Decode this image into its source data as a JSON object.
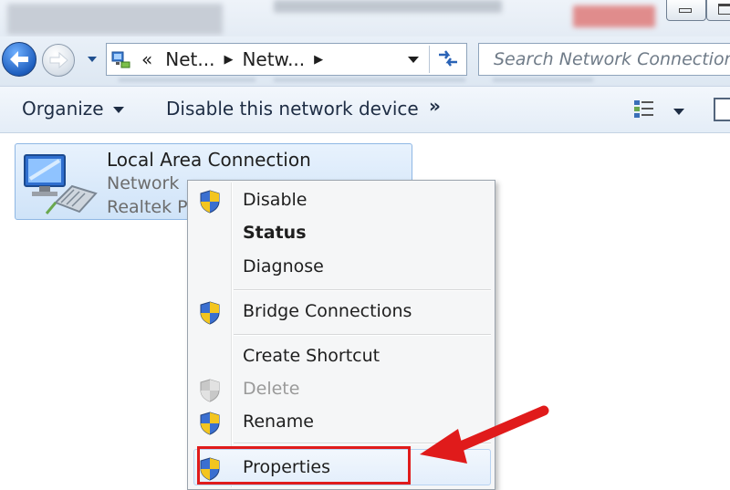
{
  "address_bar": {
    "overflow_glyph": "«",
    "crumbs": [
      "Net...",
      "Netw..."
    ],
    "search_placeholder": "Search Network Connections"
  },
  "toolbar": {
    "organize_label": "Organize",
    "disable_label": "Disable this network device",
    "more_glyph": "»"
  },
  "connection": {
    "name": "Local Area Connection",
    "status": "Network",
    "adapter": "Realtek PC"
  },
  "context_menu": {
    "items": [
      {
        "label": "Disable",
        "icon": "uac-shield-icon"
      },
      {
        "label": "Status"
      },
      {
        "label": "Diagnose"
      },
      {
        "label": "Bridge Connections",
        "icon": "uac-shield-icon"
      },
      {
        "label": "Create Shortcut"
      },
      {
        "label": "Delete",
        "icon": "uac-shield-icon",
        "state": "disabled"
      },
      {
        "label": "Rename",
        "icon": "uac-shield-icon"
      },
      {
        "label": "Properties",
        "icon": "uac-shield-icon",
        "state": "hovered"
      }
    ]
  },
  "colors": {
    "accent_blue": "#2a63b6",
    "highlight_red": "#e01b1b"
  }
}
